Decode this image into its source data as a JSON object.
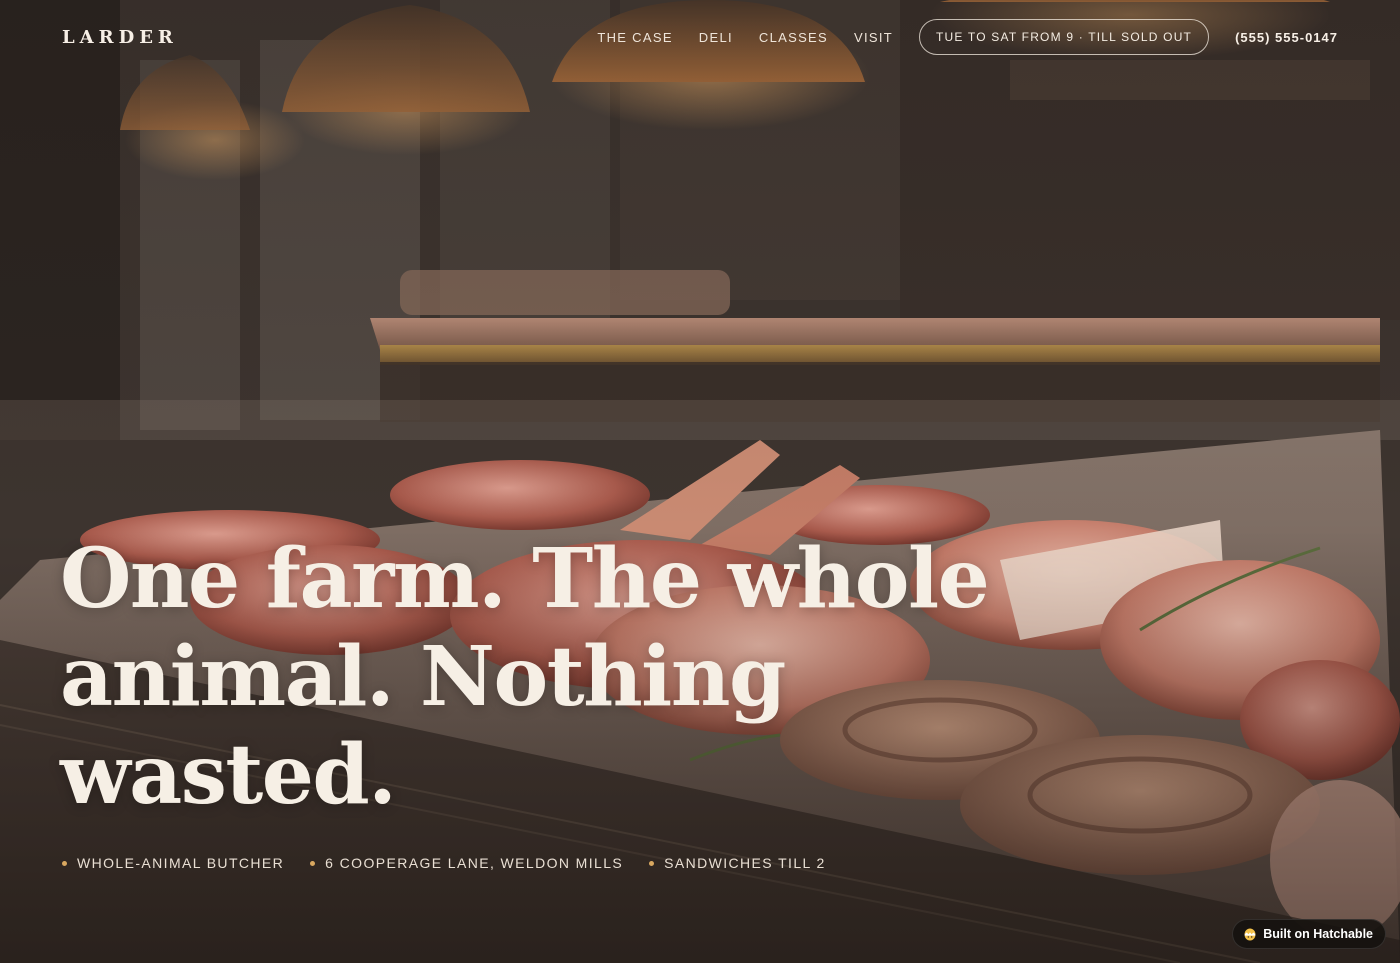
{
  "brand": {
    "logo": "LARDER"
  },
  "nav": {
    "links": [
      "THE CASE",
      "DELI",
      "CLASSES",
      "VISIT"
    ],
    "hours": "TUE TO SAT FROM 9 · TILL SOLD OUT",
    "phone": "(555) 555-0147"
  },
  "hero": {
    "headline_lines": [
      "One farm. The whole",
      "animal. Nothing",
      "wasted."
    ],
    "facts": [
      "WHOLE-ANIMAL BUTCHER",
      "6 COOPERAGE LANE, WELDON MILLS",
      "SANDWICHES TILL 2"
    ],
    "image_icon": "butcher-case-photo"
  },
  "badge": {
    "label": "Built on Hatchable",
    "icon": "hatchable-logo-icon"
  },
  "colors": {
    "accent": "#d9a860",
    "text": "#f4ece2",
    "background": "#3a302a"
  }
}
